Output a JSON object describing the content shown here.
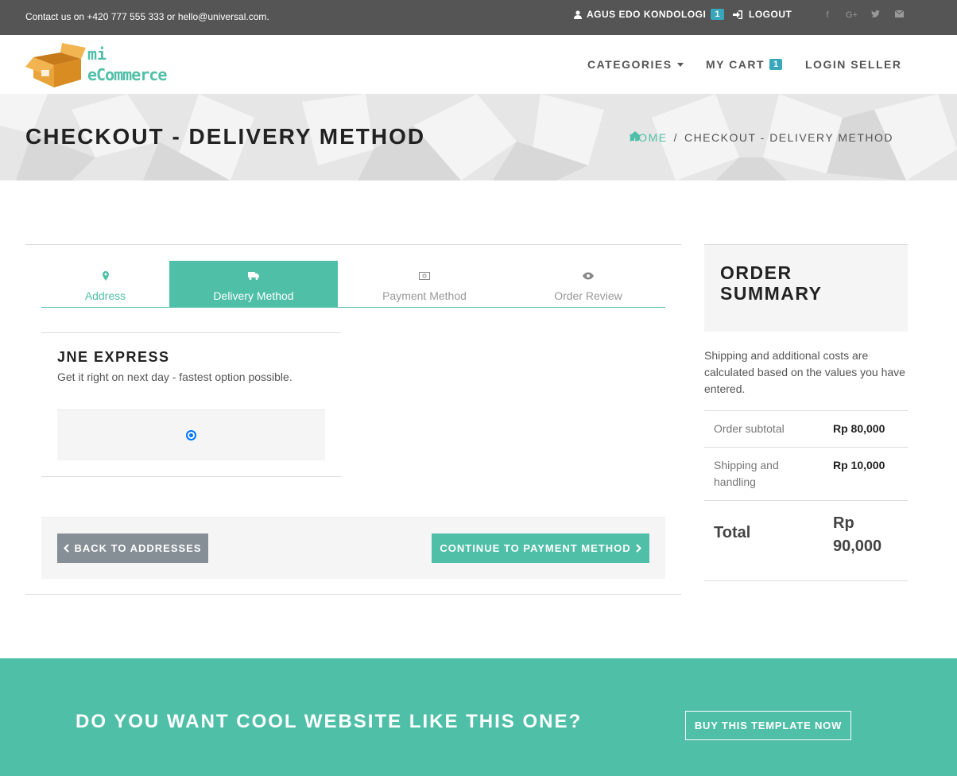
{
  "topbar": {
    "contact": "Contact us on +420 777 555 333 or hello@universal.com.",
    "user_name": "AGUS EDO KONDOLOGI",
    "user_badge": "1",
    "logout_label": "LOGOUT",
    "social_icons": [
      "facebook-icon",
      "google-plus-icon",
      "twitter-icon",
      "envelope-icon"
    ]
  },
  "logo": {
    "line1": "mi",
    "line2": "eCommerce"
  },
  "nav": {
    "categories": "CATEGORIES",
    "cart": "MY CART",
    "cart_count": "1",
    "login_seller": "LOGIN SELLER"
  },
  "heading": {
    "title": "CHECKOUT - DELIVERY METHOD",
    "breadcrumb_home": "HOME",
    "breadcrumb_sep": "/",
    "breadcrumb_current": "CHECKOUT - DELIVERY METHOD"
  },
  "tabs": [
    {
      "label": "Address",
      "icon": "map-marker-icon",
      "state": "done"
    },
    {
      "label": "Delivery Method",
      "icon": "truck-icon",
      "state": "active"
    },
    {
      "label": "Payment Method",
      "icon": "money-icon",
      "state": "pending"
    },
    {
      "label": "Order Review",
      "icon": "eye-icon",
      "state": "pending"
    }
  ],
  "delivery": {
    "name": "JNE EXPRESS",
    "description": "Get it right on next day - fastest option possible.",
    "selected": true
  },
  "actions": {
    "back": "BACK TO ADDRESSES",
    "continue": "CONTINUE TO PAYMENT METHOD"
  },
  "summary": {
    "title": "ORDER SUMMARY",
    "note": "Shipping and additional costs are calculated based on the values you have entered.",
    "subtotal_label": "Order subtotal",
    "subtotal_value": "Rp 80,000",
    "shipping_label": "Shipping and handling",
    "shipping_value": "Rp 10,000",
    "total_label": "Total",
    "total_value": "Rp 90,000"
  },
  "banner": {
    "headline": "DO YOU WANT COOL WEBSITE LIKE THIS ONE?",
    "button": "BUY THIS TEMPLATE NOW"
  },
  "colors": {
    "accent": "#4fbfa8",
    "topbar": "#555555",
    "badge": "#38a7bb",
    "back_button": "#868e96"
  }
}
